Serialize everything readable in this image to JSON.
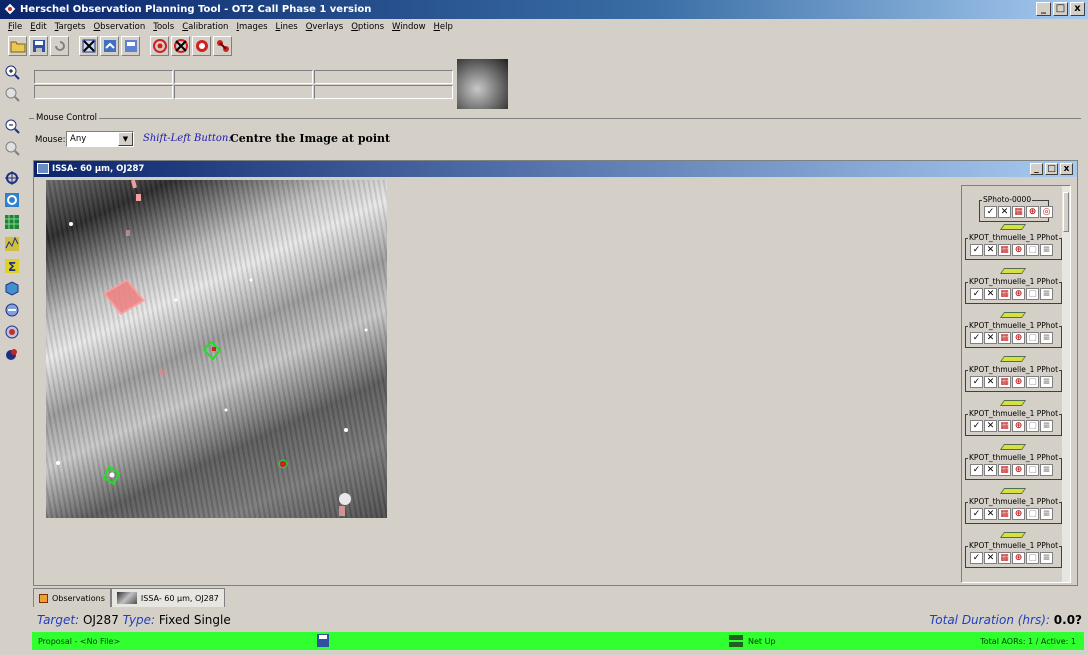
{
  "window": {
    "title": "Herschel Observation Planning Tool - OT2 Call Phase 1 version",
    "controls": [
      "_",
      "□",
      "x"
    ]
  },
  "menu": [
    "File",
    "Edit",
    "Targets",
    "Observation",
    "Tools",
    "Calibration",
    "Images",
    "Lines",
    "Overlays",
    "Options",
    "Window",
    "Help"
  ],
  "toolbar_icons": [
    "open-folder-icon",
    "save-icon",
    "undo-icon",
    "delete-aor-icon",
    "aor-import-icon",
    "aor-export-icon",
    "target-icon",
    "remove-target-icon",
    "observation-icon",
    "satellite-icon"
  ],
  "left_tools": [
    "zoom-in-icon",
    "zoom-out-icon",
    "zoom-fit-icon",
    "zoom-reset-icon",
    "crosshair-icon",
    "globe-icon",
    "grid-icon",
    "spectrum-icon",
    "sum-icon",
    "cube-icon",
    "catalog-icon",
    "visibility-icon",
    "aor-icon"
  ],
  "mouse_control": {
    "legend": "Mouse Control",
    "label": "Mouse:",
    "mode": "Any",
    "hint_key": "Shift-Left Button:",
    "hint_action": "Centre the Image at point"
  },
  "inner_window": {
    "title": "ISSA- 60 µm,  OJ287",
    "controls": [
      "_",
      "□",
      "x"
    ]
  },
  "aor_panel": {
    "first": {
      "label": "SPhoto-0000"
    },
    "items": [
      {
        "label": "KPOT_thmuelle_1 PPhot"
      },
      {
        "label": "KPOT_thmuelle_1 PPhot"
      },
      {
        "label": "KPOT_thmuelle_1 PPhot"
      },
      {
        "label": "KPOT_thmuelle_1 PPhot"
      },
      {
        "label": "KPOT_thmuelle_1 PPhot"
      },
      {
        "label": "KPOT_thmuelle_1 PPhot"
      },
      {
        "label": "KPOT_thmuelle_1 PPhot"
      },
      {
        "label": "KPOT_thmuelle_1 PPhot"
      }
    ]
  },
  "tabs": [
    {
      "label": "Observations"
    },
    {
      "label": "ISSA- 60 µm,  OJ287"
    }
  ],
  "target": {
    "target_key": "Target:",
    "target_value": "OJ287",
    "type_key": "Type:",
    "type_value": "Fixed Single"
  },
  "duration": {
    "key": "Total Duration (hrs):",
    "value": "0.0?"
  },
  "status": {
    "proposal": "Proposal - <No File>",
    "net": "Net Up",
    "aors": "Total AORs: 1  / Active: 1",
    "color": "#30ff30"
  }
}
